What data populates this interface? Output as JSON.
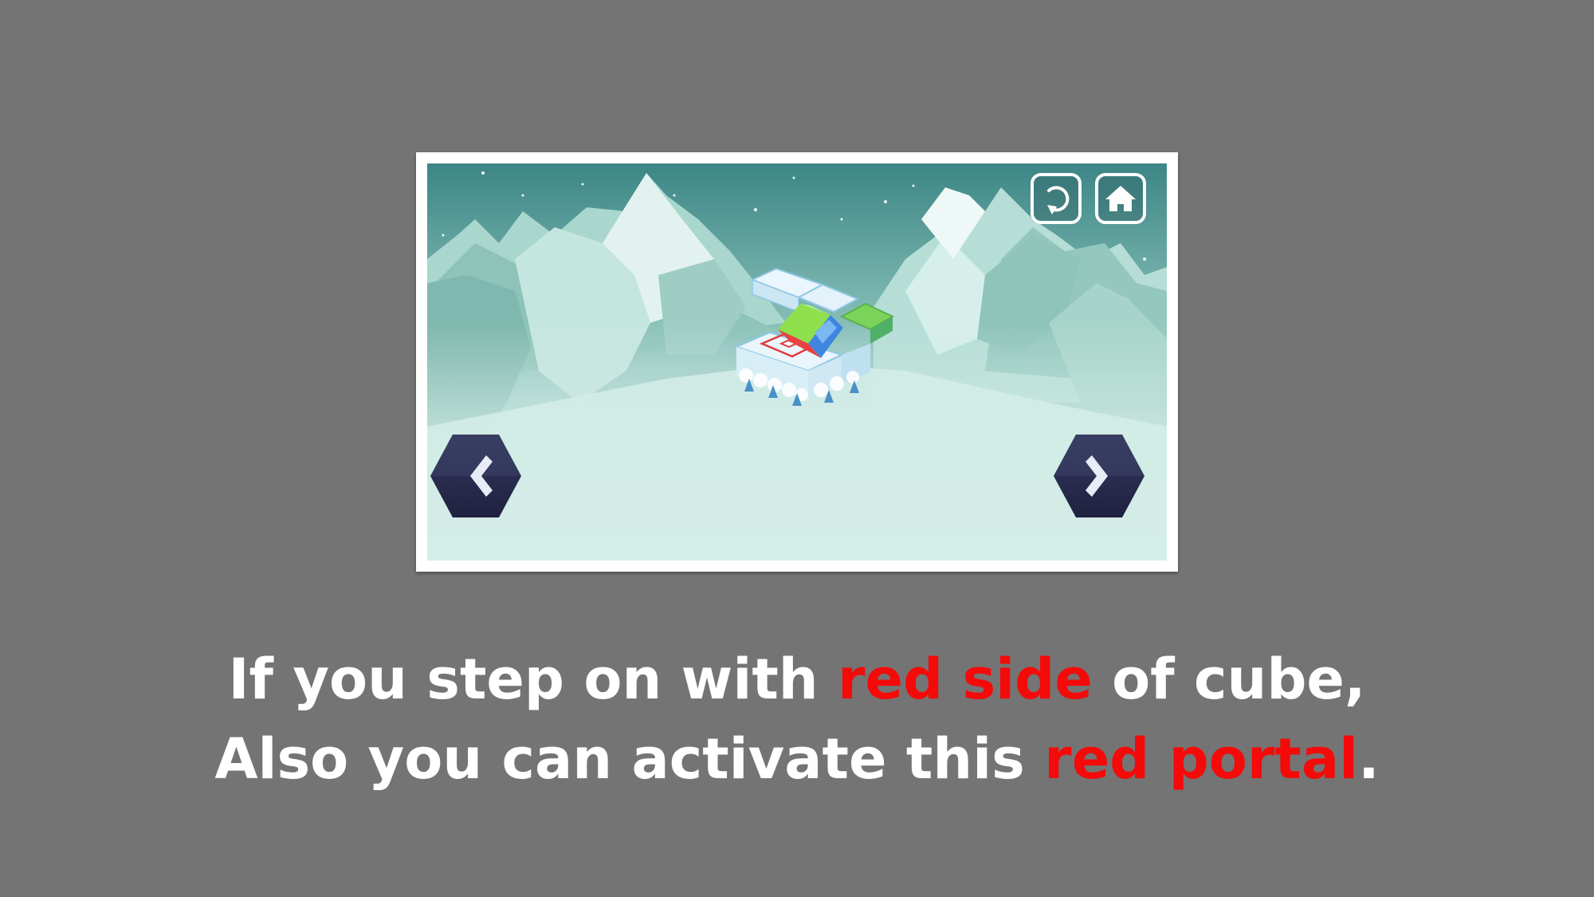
{
  "game": {
    "hud": {
      "restart_icon": "restart-icon",
      "home_icon": "home-icon"
    },
    "nav": {
      "prev_icon": "chevron-left-icon",
      "next_icon": "chevron-right-icon"
    }
  },
  "caption": {
    "line1": {
      "before": "If you step on with ",
      "highlight": "red side",
      "after": " of cube,"
    },
    "line2": {
      "before": "Also you can activate this ",
      "highlight": "red portal",
      "after": "."
    }
  },
  "colors": {
    "background": "#747474",
    "highlight": "#f50a0a",
    "caption": "#ffffff",
    "sky": "#3f8a8a",
    "nav_button": "#2a2b4a"
  }
}
